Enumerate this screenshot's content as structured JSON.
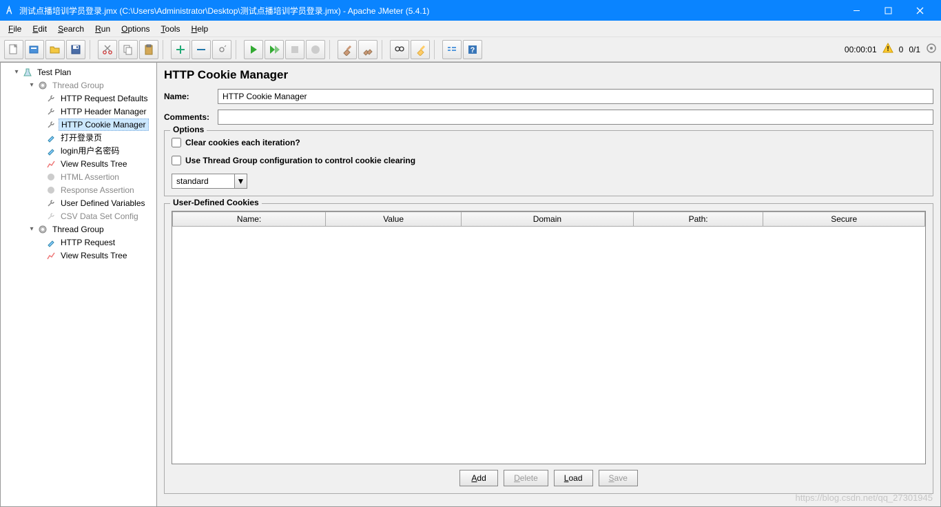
{
  "titlebar": {
    "text": "测试点播培训学员登录.jmx (C:\\Users\\Administrator\\Desktop\\测试点播培训学员登录.jmx) - Apache JMeter (5.4.1)"
  },
  "menubar": {
    "file": "File",
    "edit": "Edit",
    "search": "Search",
    "run": "Run",
    "options": "Options",
    "tools": "Tools",
    "help": "Help"
  },
  "toolbar_status": {
    "elapsed": "00:00:01",
    "active": "0",
    "threads": "0/1"
  },
  "tree": {
    "test_plan": "Test Plan",
    "tg1": "Thread Group",
    "http_req_defaults": "HTTP Request Defaults",
    "http_header_mgr": "HTTP Header Manager",
    "http_cookie_mgr": "HTTP Cookie Manager",
    "open_login": "打开登录页",
    "login_userpass": "login用户名密码",
    "view_results_tree": "View Results Tree",
    "html_assertion": "HTML Assertion",
    "response_assertion": "Response Assertion",
    "user_defined_vars": "User Defined Variables",
    "csv_config": "CSV Data Set Config",
    "tg2": "Thread Group",
    "http_request": "HTTP Request",
    "view_results_tree2": "View Results Tree"
  },
  "panel": {
    "title": "HTTP Cookie Manager",
    "name_label": "Name:",
    "name_value": "HTTP Cookie Manager",
    "comments_label": "Comments:",
    "comments_value": ""
  },
  "options": {
    "legend": "Options",
    "clear_each": "Clear cookies each iteration?",
    "use_tg_config": "Use Thread Group configuration to control cookie clearing",
    "policy": "standard"
  },
  "cookies": {
    "legend": "User-Defined Cookies",
    "columns": {
      "name": "Name:",
      "value": "Value",
      "domain": "Domain",
      "path": "Path:",
      "secure": "Secure"
    },
    "rows": []
  },
  "buttons": {
    "add": "Add",
    "delete": "Delete",
    "load": "Load",
    "save": "Save"
  },
  "watermark": "https://blog.csdn.net/qq_27301945"
}
